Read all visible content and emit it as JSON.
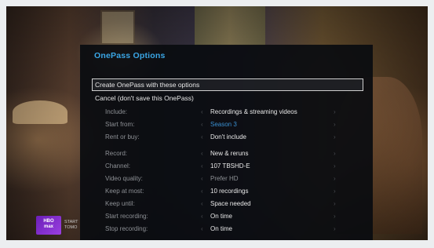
{
  "dialog": {
    "title": "OnePass Options",
    "actions": [
      {
        "label": "Create OnePass with these options",
        "selected": true
      },
      {
        "label": "Cancel (don't save this OnePass)",
        "selected": false
      }
    ],
    "group1": [
      {
        "label": "Include:",
        "value": "Recordings & streaming videos",
        "state": "normal"
      },
      {
        "label": "Start from:",
        "value": "Season 3",
        "state": "highlight"
      },
      {
        "label": "Rent or buy:",
        "value": "Don't include",
        "state": "normal"
      }
    ],
    "group2": [
      {
        "label": "Record:",
        "value": "New & reruns",
        "state": "normal"
      },
      {
        "label": "Channel:",
        "value": "107 TBSHD-E",
        "state": "normal"
      },
      {
        "label": "Video quality:",
        "value": "Prefer HD",
        "state": "disabled"
      },
      {
        "label": "Keep at most:",
        "value": "10 recordings",
        "state": "normal"
      },
      {
        "label": "Keep until:",
        "value": "Space needed",
        "state": "normal"
      },
      {
        "label": "Start recording:",
        "value": "On time",
        "state": "normal"
      },
      {
        "label": "Stop recording:",
        "value": "On time",
        "state": "normal"
      }
    ],
    "arrow_left": "‹",
    "arrow_right": "›"
  },
  "background_ad": {
    "logo_line1": "HBO",
    "logo_line2": "max",
    "text_line1": "START",
    "text_line2": "TOMO"
  }
}
